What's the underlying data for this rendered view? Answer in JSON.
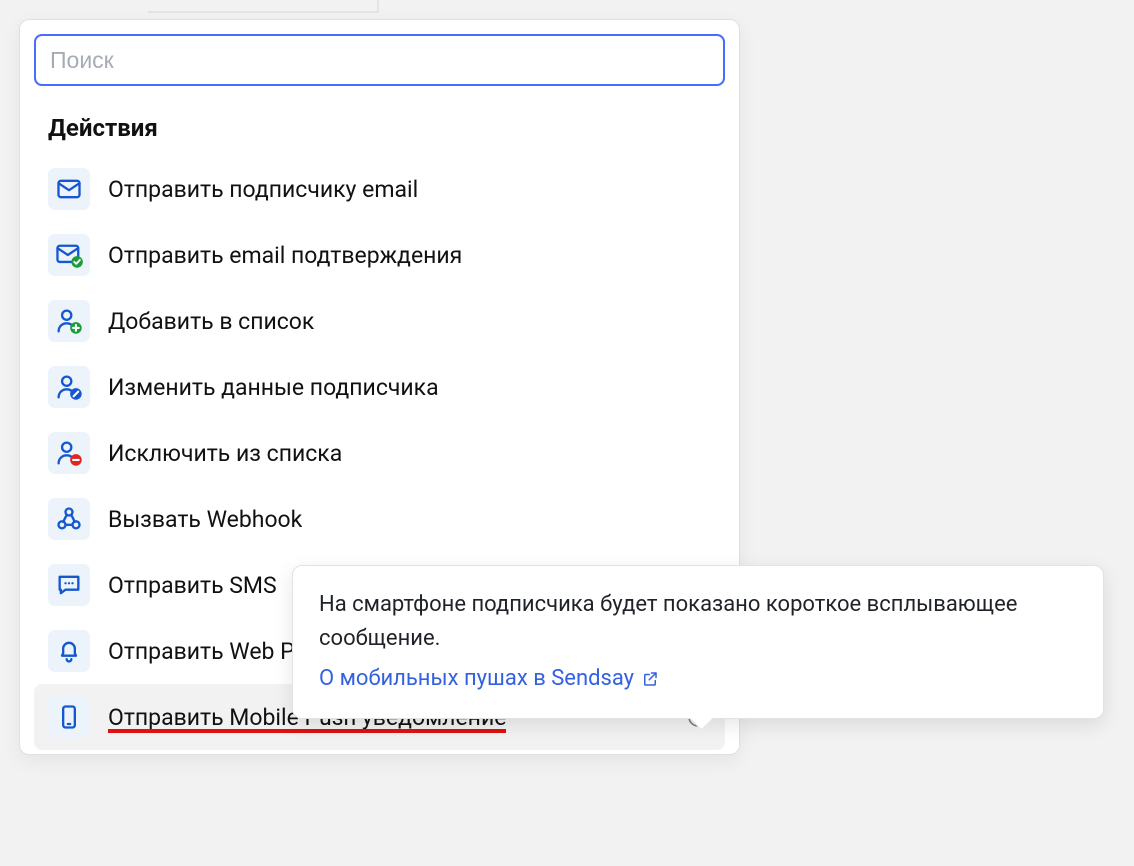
{
  "search": {
    "placeholder": "Поиск",
    "value": ""
  },
  "section_title": "Действия",
  "actions": [
    {
      "icon": "mail-icon",
      "label": "Отправить подписчику email"
    },
    {
      "icon": "mail-check-icon",
      "label": "Отправить email подтверждения"
    },
    {
      "icon": "user-plus-icon",
      "label": "Добавить в список"
    },
    {
      "icon": "user-edit-icon",
      "label": "Изменить данные подписчика"
    },
    {
      "icon": "user-minus-icon",
      "label": "Исключить из списка"
    },
    {
      "icon": "webhook-icon",
      "label": "Вызвать Webhook"
    },
    {
      "icon": "sms-icon",
      "label": "Отправить SMS"
    },
    {
      "icon": "bell-icon",
      "label": "Отправить Web Push"
    },
    {
      "icon": "phone-icon",
      "label": "Отправить Mobile Push уведомление",
      "selected": true,
      "info": true
    }
  ],
  "tooltip": {
    "text": "На смартфоне подписчика будет показано короткое всплывающее сообщение.",
    "link_text": "О мобильных пушах в Sendsay"
  }
}
